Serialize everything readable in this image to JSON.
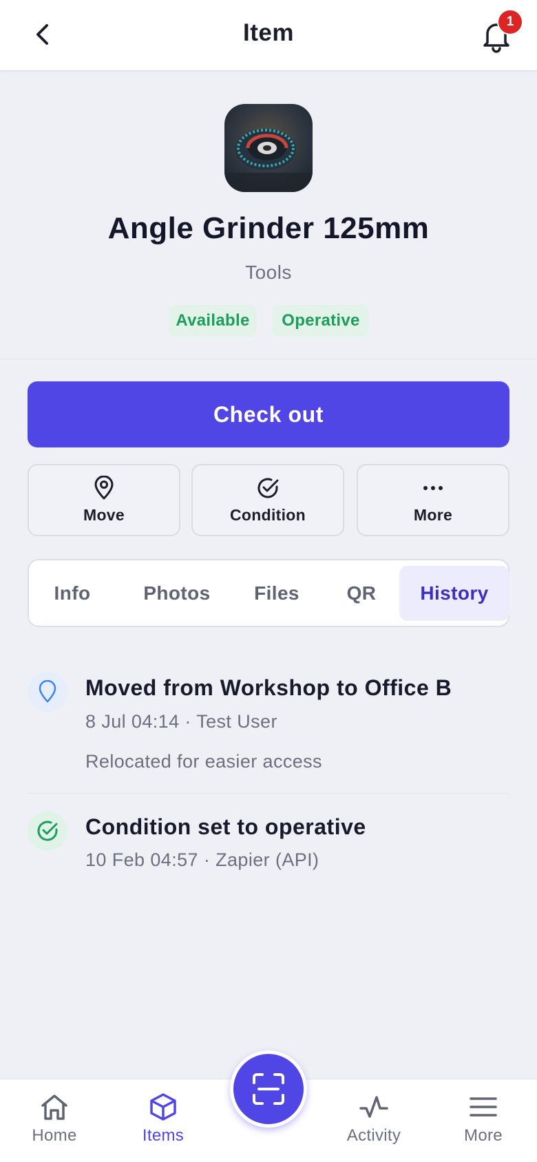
{
  "header": {
    "title": "Item",
    "notification_count": "1"
  },
  "item": {
    "name": "Angle Grinder 125mm",
    "category": "Tools",
    "tags": [
      "Available",
      "Operative"
    ]
  },
  "actions": {
    "checkout_label": "Check out",
    "move_label": "Move",
    "condition_label": "Condition",
    "more_label": "More"
  },
  "tabs": [
    {
      "label": "Info"
    },
    {
      "label": "Photos"
    },
    {
      "label": "Files"
    },
    {
      "label": "QR"
    },
    {
      "label": "History",
      "active": true
    }
  ],
  "history": [
    {
      "icon": "location-pin-icon",
      "title": "Moved from Workshop to Office B",
      "meta": "8 Jul 04:14 · Test User",
      "note": "Relocated for easier access"
    },
    {
      "icon": "check-circle-icon",
      "title": "Condition set to operative",
      "meta": "10 Feb 04:57 · Zapier (API)"
    }
  ],
  "bottom_nav": {
    "home": "Home",
    "items": "Items",
    "activity": "Activity",
    "more": "More"
  },
  "colors": {
    "accent": "#4f46e5",
    "tag_green": "#1a9e5a",
    "badge_red": "#dc2626"
  }
}
